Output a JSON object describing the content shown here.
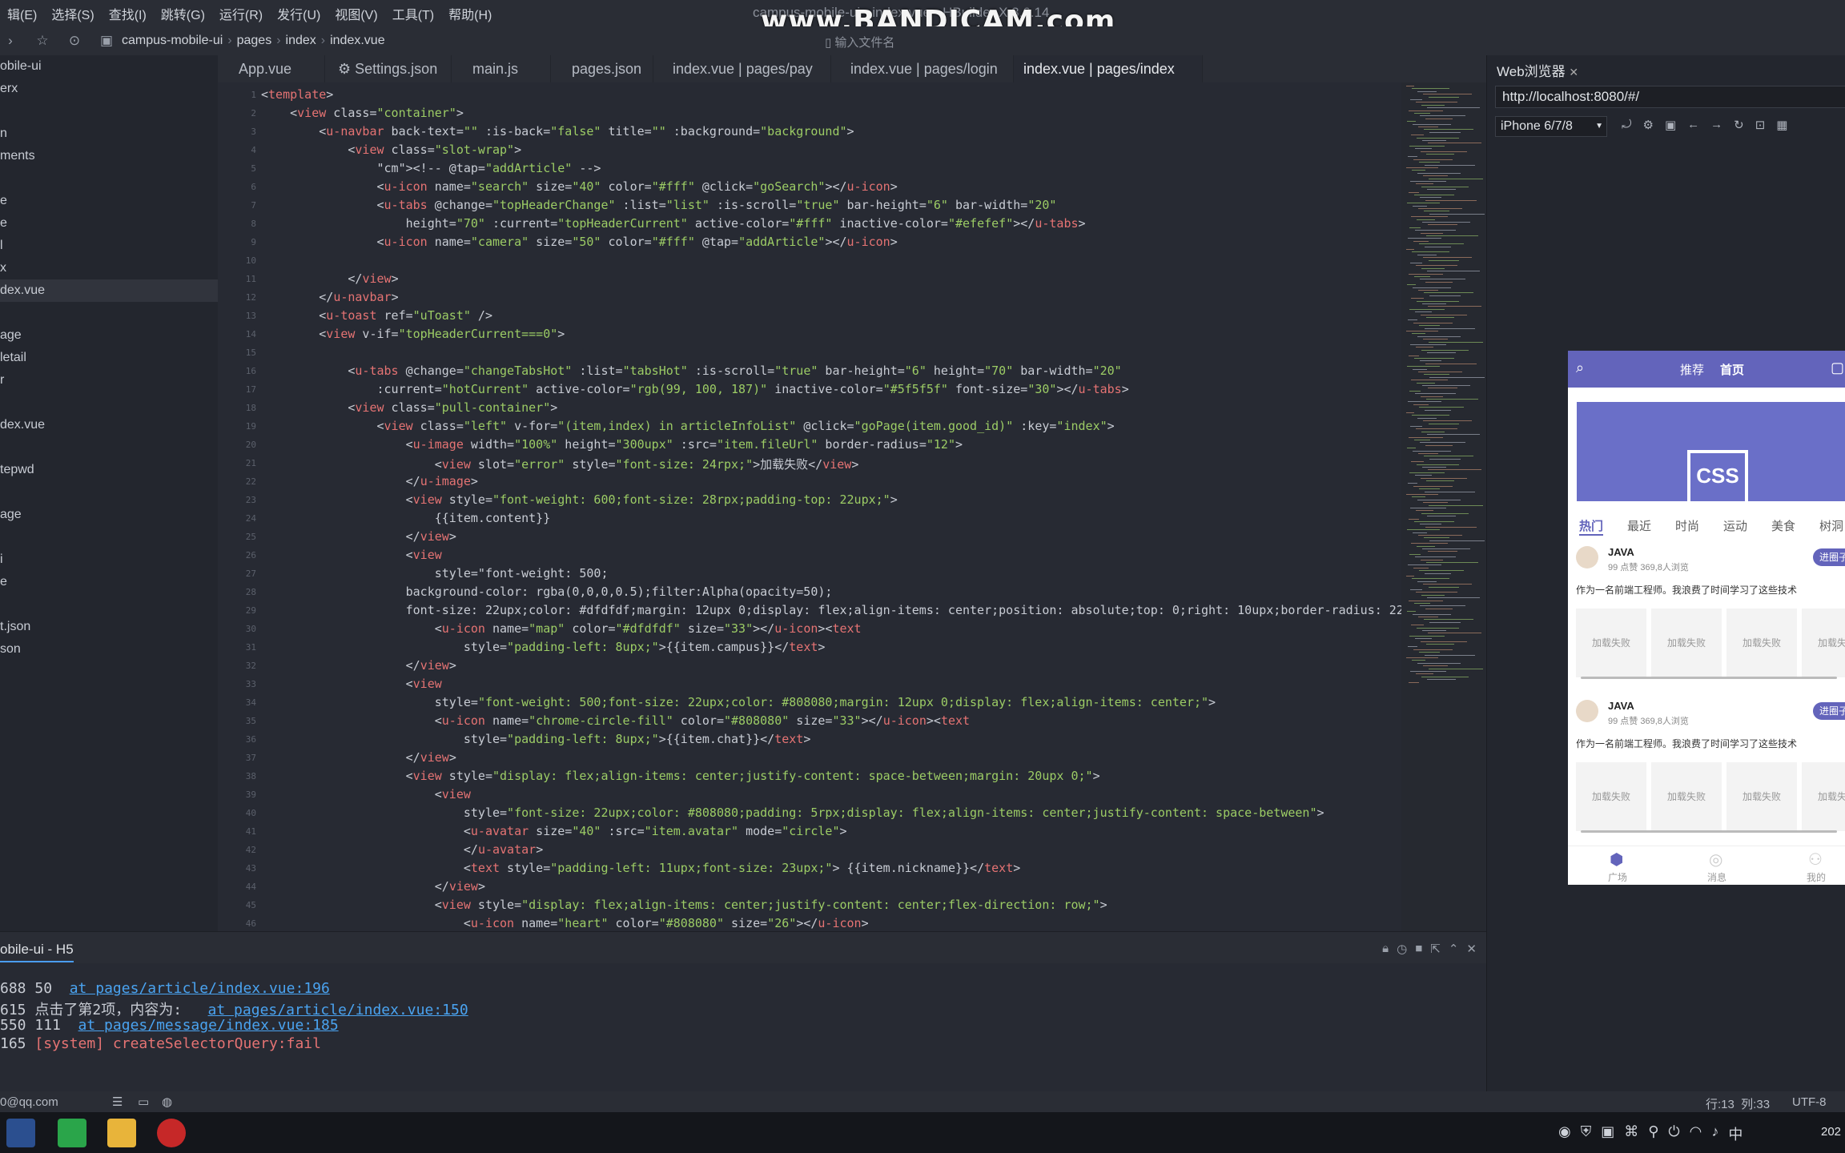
{
  "menu": {
    "items": [
      "辑(E)",
      "选择(S)",
      "查找(I)",
      "跳转(G)",
      "运行(R)",
      "发行(U)",
      "视图(V)",
      "工具(T)",
      "帮助(H)"
    ],
    "window_title": "campus-mobile-ui - index.vue - HBuilder X 3.6.14",
    "watermark": "www.BANDICAM.com"
  },
  "toolbar": {
    "breadcrumb": [
      "campus-mobile-ui",
      "pages",
      "index",
      "index.vue"
    ],
    "file_input_placeholder": "输入文件名"
  },
  "sidebar": {
    "items": [
      "obile-ui",
      "erx",
      "",
      "n",
      "ments",
      "",
      "e",
      "e",
      "l",
      "x",
      "dex.vue",
      "",
      "age",
      "letail",
      "r",
      "",
      "dex.vue",
      "",
      "tepwd",
      "",
      "age",
      "",
      "i",
      "e",
      "",
      "t.json",
      "son"
    ]
  },
  "tabs": [
    "App.vue",
    "⚙ Settings.json",
    "main.js",
    "pages.json",
    "index.vue | pages/pay",
    "index.vue | pages/login",
    "index.vue | pages/index"
  ],
  "console": {
    "title": "obile-ui - H5",
    "lines": [
      {
        "n": "688",
        "t": "50  ",
        "l": "at pages/article/index.vue:196"
      },
      {
        "n": "615",
        "t": "点击了第2项，内容为:   ",
        "l": "at pages/article/index.vue:150"
      },
      {
        "n": "550",
        "t": "111  ",
        "l": "at pages/message/index.vue:185"
      },
      {
        "n": "165",
        "t": "",
        "l": "",
        "sys": "[system] createSelectorQuery:fail"
      }
    ]
  },
  "status": {
    "account": "0@qq.com",
    "position": "行:13  列:33",
    "encoding": "UTF-8"
  },
  "browser": {
    "tab": "Web浏览器",
    "url": "http://localhost:8080/#/",
    "device": "iPhone 6/7/8"
  },
  "phone": {
    "nav_tabs": [
      "推荐",
      "首页"
    ],
    "banner_text": "CSS",
    "hot_tabs": [
      "热门",
      "最近",
      "时尚",
      "运动",
      "美食",
      "树洞"
    ],
    "posts": [
      {
        "name": "JAVA",
        "sub": "99 点赞 369,8人浏览",
        "desc": "作为一名前端工程师。我浪费了时间学习了这些技术",
        "follow": "进圈子",
        "ph": "加载失败"
      },
      {
        "name": "JAVA",
        "sub": "99 点赞 369,8人浏览",
        "desc": "作为一名前端工程师。我浪费了时间学习了这些技术",
        "follow": "进圈子",
        "ph": "加载失败"
      }
    ],
    "tabbar": [
      "广场",
      "消息",
      "我的"
    ]
  },
  "taskbar": {
    "clock": "202"
  },
  "colors": {
    "accent": "#6364bb",
    "link": "#4aa3f0"
  }
}
